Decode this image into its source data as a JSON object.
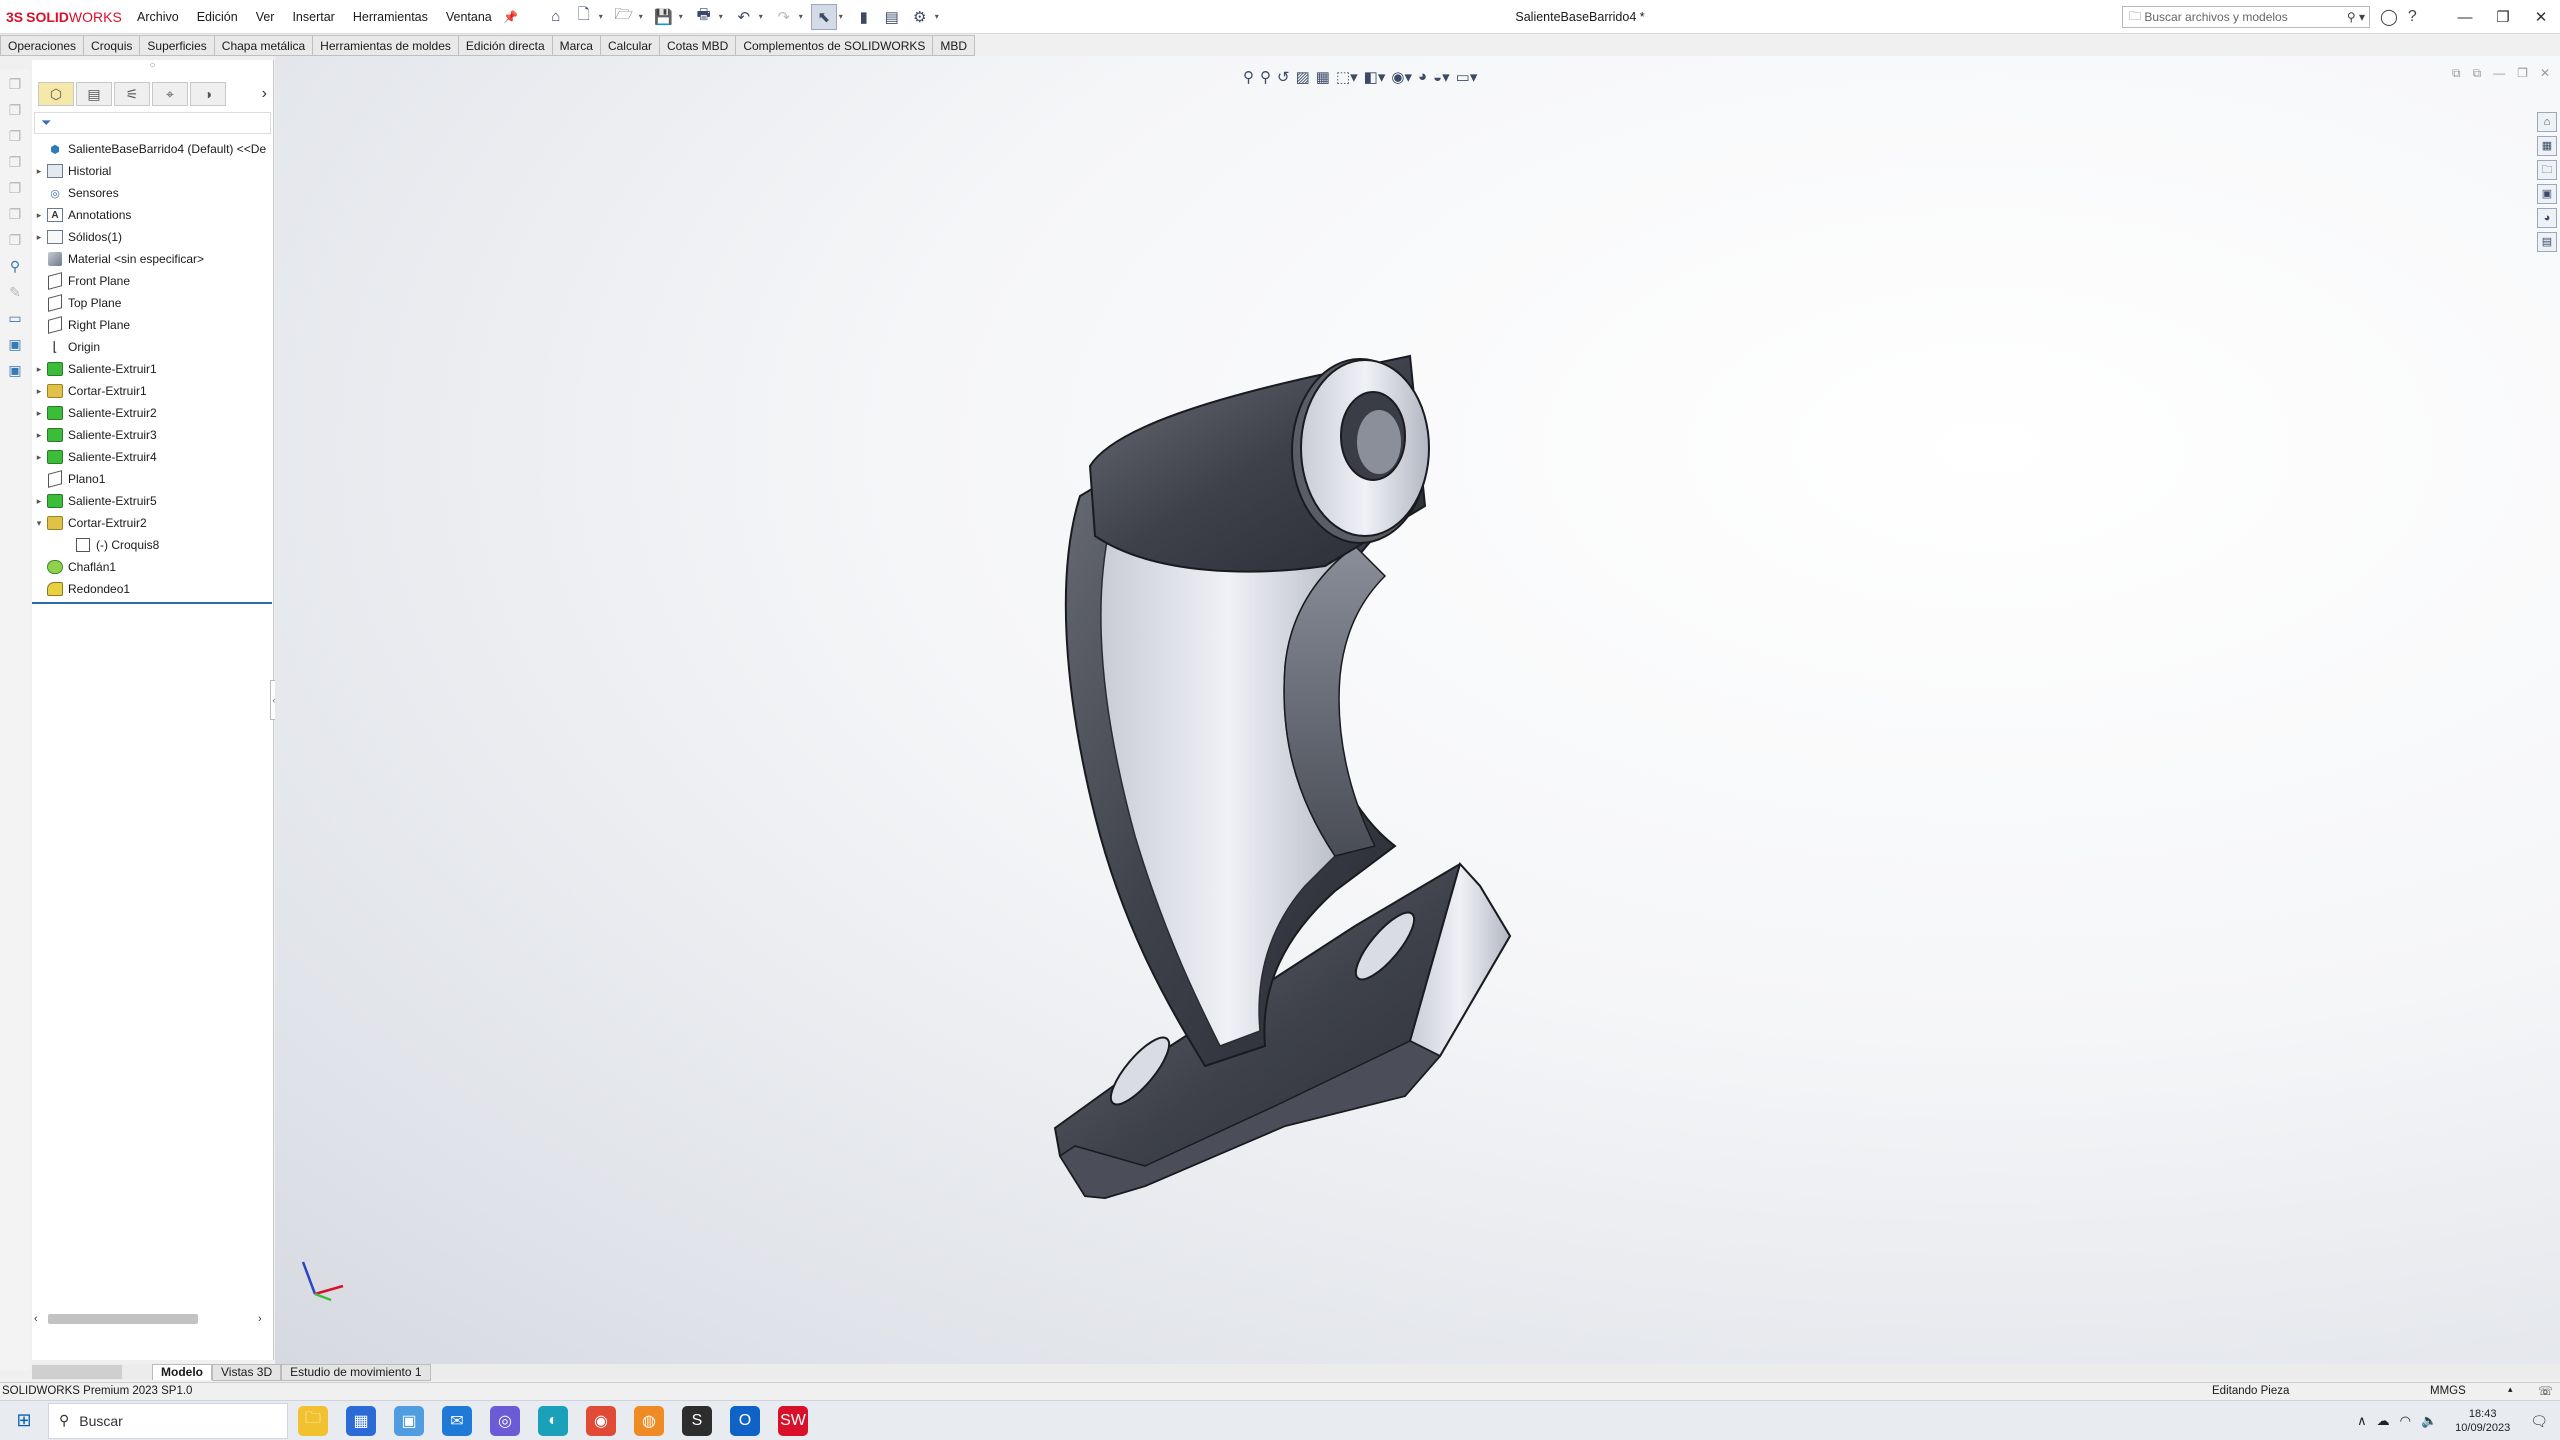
{
  "app": {
    "logo_ds": "3S",
    "logo_text_bold": "SOLID",
    "logo_text_light": "WORKS",
    "document_title": "SalienteBaseBarrido4 *"
  },
  "menu": [
    "Archivo",
    "Edición",
    "Ver",
    "Insertar",
    "Herramientas",
    "Ventana"
  ],
  "search": {
    "placeholder": "Buscar archivos y modelos"
  },
  "command_tabs": [
    "Operaciones",
    "Croquis",
    "Superficies",
    "Chapa metálica",
    "Herramientas de moldes",
    "Edición directa",
    "Marca",
    "Calcular",
    "Cotas MBD",
    "Complementos de SOLIDWORKS",
    "MBD"
  ],
  "tree": {
    "root": "SalienteBaseBarrido4 (Default) <<De",
    "items": [
      {
        "label": "Historial",
        "icon": "folder-icon",
        "expandable": true
      },
      {
        "label": "Sensores",
        "icon": "sensor-icon",
        "expandable": false
      },
      {
        "label": "Annotations",
        "icon": "annotations-icon",
        "expandable": true
      },
      {
        "label": "Sólidos(1)",
        "icon": "solid-bodies-icon",
        "expandable": true
      },
      {
        "label": "Material <sin especificar>",
        "icon": "material-icon",
        "expandable": false
      },
      {
        "label": "Front Plane",
        "icon": "plane-icon",
        "expandable": false
      },
      {
        "label": "Top Plane",
        "icon": "plane-icon",
        "expandable": false
      },
      {
        "label": "Right Plane",
        "icon": "plane-icon",
        "expandable": false
      },
      {
        "label": "Origin",
        "icon": "origin-icon",
        "expandable": false
      },
      {
        "label": "Saliente-Extruir1",
        "icon": "boss-extrude-icon",
        "expandable": true
      },
      {
        "label": "Cortar-Extruir1",
        "icon": "cut-extrude-icon",
        "expandable": true
      },
      {
        "label": "Saliente-Extruir2",
        "icon": "boss-extrude-icon",
        "expandable": true
      },
      {
        "label": "Saliente-Extruir3",
        "icon": "boss-extrude-icon",
        "expandable": true
      },
      {
        "label": "Saliente-Extruir4",
        "icon": "boss-extrude-icon",
        "expandable": true
      },
      {
        "label": "Plano1",
        "icon": "plane-icon",
        "expandable": false
      },
      {
        "label": "Saliente-Extruir5",
        "icon": "boss-extrude-icon",
        "expandable": true
      },
      {
        "label": "Cortar-Extruir2",
        "icon": "cut-extrude-icon",
        "expandable": true,
        "expanded": true
      },
      {
        "label": "(-) Croquis8",
        "icon": "sketch-icon",
        "expandable": false,
        "child": true
      },
      {
        "label": "Chaflán1",
        "icon": "chamfer-icon",
        "expandable": false
      },
      {
        "label": "Redondeo1",
        "icon": "fillet-icon",
        "expandable": false
      }
    ]
  },
  "bottom_tabs": [
    "Modelo",
    "Vistas 3D",
    "Estudio de movimiento 1"
  ],
  "status": {
    "product": "SOLIDWORKS Premium 2023 SP1.0",
    "mode": "Editando Pieza",
    "units": "MMGS"
  },
  "taskbar": {
    "search_label": "Buscar",
    "time": "18:43",
    "date": "10/09/2023"
  },
  "colors": {
    "brand": "#d8102a",
    "accent": "#2b6cb0",
    "boss_feature": "#3bbd3a",
    "cut_feature": "#e0c24a"
  }
}
